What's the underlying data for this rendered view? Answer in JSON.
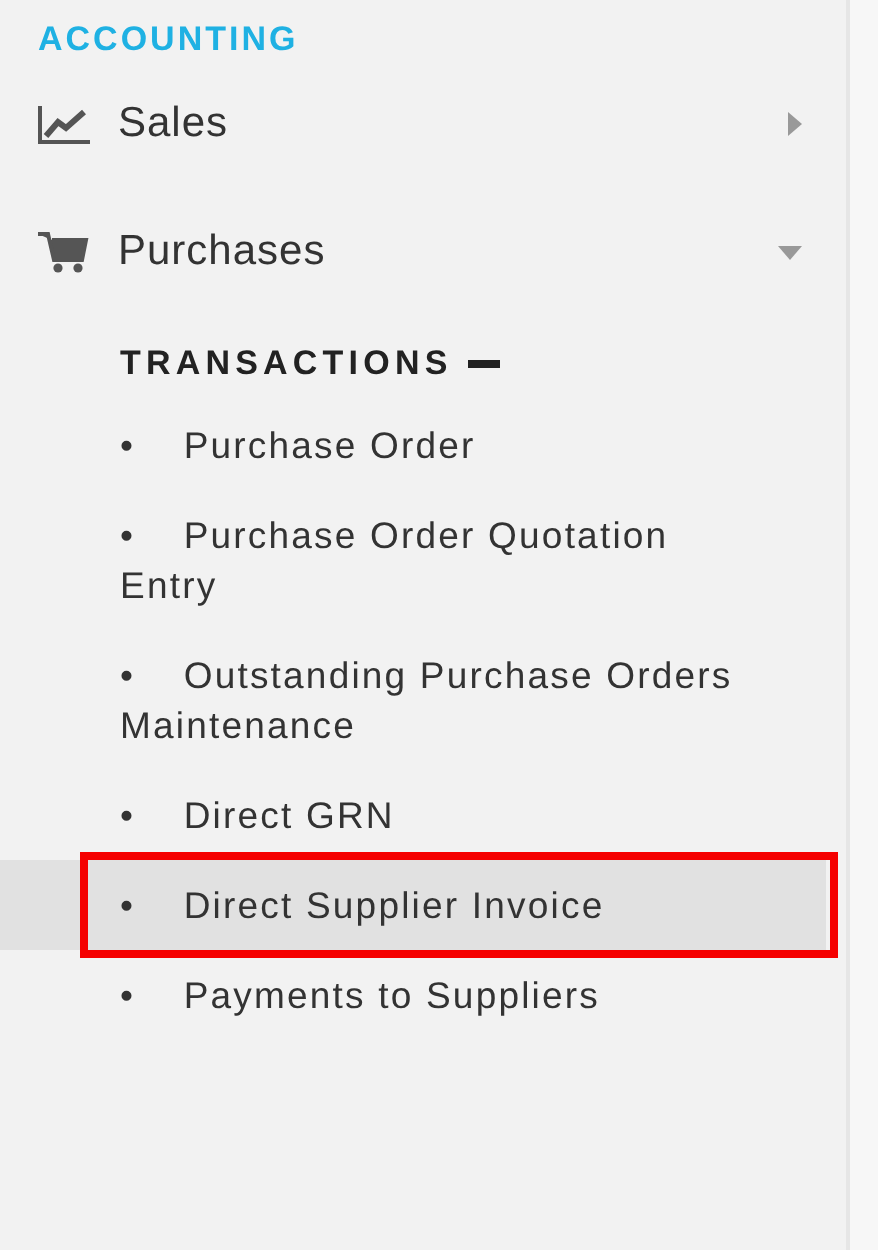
{
  "section_title": "ACCOUNTING",
  "menu": [
    {
      "kind": "chart",
      "label": "Sales",
      "expanded": false
    },
    {
      "kind": "cart",
      "label": "Purchases",
      "expanded": true,
      "group": {
        "title": "TRANSACTIONS",
        "expanded": true,
        "items": [
          {
            "bullet": "•",
            "label": "Purchase Order",
            "selected": false,
            "outlined": false
          },
          {
            "bullet": "•",
            "label": "Purchase Order Quotation Entry",
            "selected": false,
            "outlined": false
          },
          {
            "bullet": "•",
            "label": "Outstanding Purchase Orders Maintenance",
            "selected": false,
            "outlined": false
          },
          {
            "bullet": "•",
            "label": "Direct GRN",
            "selected": false,
            "outlined": false
          },
          {
            "bullet": "•",
            "label": "Direct Supplier Invoice",
            "selected": true,
            "outlined": true
          },
          {
            "bullet": "•",
            "label": "Payments to Suppliers",
            "selected": false,
            "outlined": false
          }
        ]
      }
    }
  ]
}
